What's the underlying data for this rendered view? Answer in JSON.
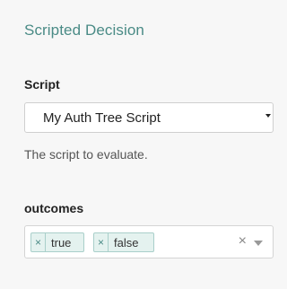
{
  "panel": {
    "title": "Scripted Decision"
  },
  "script_field": {
    "label": "Script",
    "selected_value": "My Auth Tree Script",
    "help_text": "The script to evaluate."
  },
  "outcomes_field": {
    "label": "outcomes",
    "tags": [
      {
        "remove_glyph": "×",
        "label": "true"
      },
      {
        "remove_glyph": "×",
        "label": "false"
      }
    ],
    "clear_glyph": "×"
  },
  "colors": {
    "accent": "#4a8b86",
    "tag_background": "#e4f2ef",
    "tag_border": "#a9cfca",
    "panel_background": "#f7f7f7"
  },
  "icons": {
    "select_caret": "caret-down-icon",
    "tag_remove": "close-icon",
    "clear": "clear-icon",
    "dropdown": "chevron-down-icon"
  }
}
